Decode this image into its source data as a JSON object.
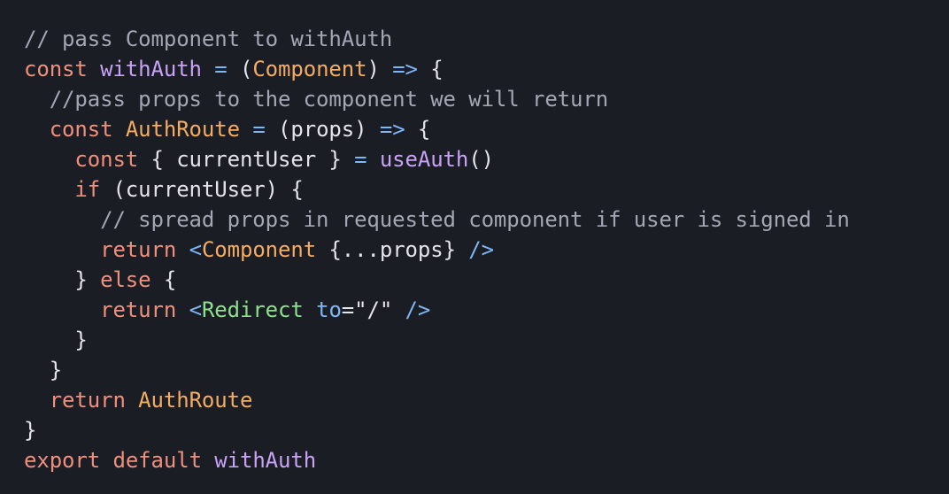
{
  "colors": {
    "background": "#1b1d24",
    "comment": "#a3a7b3",
    "keyword": "#ef8f7c",
    "function": "#c9a2f7",
    "type": "#f4ac63",
    "operator": "#7fb6f5",
    "plain": "#e3e5ea",
    "tag": "#8de08b"
  },
  "code": {
    "lines": [
      [
        {
          "t": "// pass Component to withAuth",
          "c": "comment"
        }
      ],
      [
        {
          "t": "const",
          "c": "keyword"
        },
        {
          "t": " ",
          "c": "plain"
        },
        {
          "t": "withAuth",
          "c": "function"
        },
        {
          "t": " ",
          "c": "plain"
        },
        {
          "t": "=",
          "c": "operator"
        },
        {
          "t": " (",
          "c": "plain"
        },
        {
          "t": "Component",
          "c": "type"
        },
        {
          "t": ") ",
          "c": "plain"
        },
        {
          "t": "=>",
          "c": "operator"
        },
        {
          "t": " {",
          "c": "plain"
        }
      ],
      [
        {
          "t": "  //pass props to the component we will return",
          "c": "comment"
        }
      ],
      [
        {
          "t": "  ",
          "c": "plain"
        },
        {
          "t": "const",
          "c": "keyword"
        },
        {
          "t": " ",
          "c": "plain"
        },
        {
          "t": "AuthRoute",
          "c": "type"
        },
        {
          "t": " ",
          "c": "plain"
        },
        {
          "t": "=",
          "c": "operator"
        },
        {
          "t": " (props) ",
          "c": "plain"
        },
        {
          "t": "=>",
          "c": "operator"
        },
        {
          "t": " {",
          "c": "plain"
        }
      ],
      [
        {
          "t": "    ",
          "c": "plain"
        },
        {
          "t": "const",
          "c": "keyword"
        },
        {
          "t": " { currentUser } ",
          "c": "plain"
        },
        {
          "t": "=",
          "c": "operator"
        },
        {
          "t": " ",
          "c": "plain"
        },
        {
          "t": "useAuth",
          "c": "function"
        },
        {
          "t": "()",
          "c": "plain"
        }
      ],
      [
        {
          "t": "    ",
          "c": "plain"
        },
        {
          "t": "if",
          "c": "keyword"
        },
        {
          "t": " (currentUser) {",
          "c": "plain"
        }
      ],
      [
        {
          "t": "      // spread props in requested component if user is signed in",
          "c": "comment"
        }
      ],
      [
        {
          "t": "      ",
          "c": "plain"
        },
        {
          "t": "return",
          "c": "keyword"
        },
        {
          "t": " ",
          "c": "plain"
        },
        {
          "t": "<",
          "c": "operator"
        },
        {
          "t": "Component",
          "c": "type"
        },
        {
          "t": " {...props} ",
          "c": "plain"
        },
        {
          "t": "/>",
          "c": "operator"
        }
      ],
      [
        {
          "t": "    } ",
          "c": "plain"
        },
        {
          "t": "else",
          "c": "keyword"
        },
        {
          "t": " {",
          "c": "plain"
        }
      ],
      [
        {
          "t": "      ",
          "c": "plain"
        },
        {
          "t": "return",
          "c": "keyword"
        },
        {
          "t": " ",
          "c": "plain"
        },
        {
          "t": "<",
          "c": "operator"
        },
        {
          "t": "Redirect",
          "c": "tag"
        },
        {
          "t": " ",
          "c": "plain"
        },
        {
          "t": "to",
          "c": "operator"
        },
        {
          "t": "=\"/\" ",
          "c": "plain"
        },
        {
          "t": "/>",
          "c": "operator"
        }
      ],
      [
        {
          "t": "    }",
          "c": "plain"
        }
      ],
      [
        {
          "t": "  }",
          "c": "plain"
        }
      ],
      [
        {
          "t": "  ",
          "c": "plain"
        },
        {
          "t": "return",
          "c": "keyword"
        },
        {
          "t": " ",
          "c": "plain"
        },
        {
          "t": "AuthRoute",
          "c": "type"
        }
      ],
      [
        {
          "t": "}",
          "c": "plain"
        }
      ],
      [
        {
          "t": "export",
          "c": "keyword"
        },
        {
          "t": " ",
          "c": "plain"
        },
        {
          "t": "default",
          "c": "keyword"
        },
        {
          "t": " ",
          "c": "plain"
        },
        {
          "t": "withAuth",
          "c": "function"
        }
      ]
    ]
  }
}
